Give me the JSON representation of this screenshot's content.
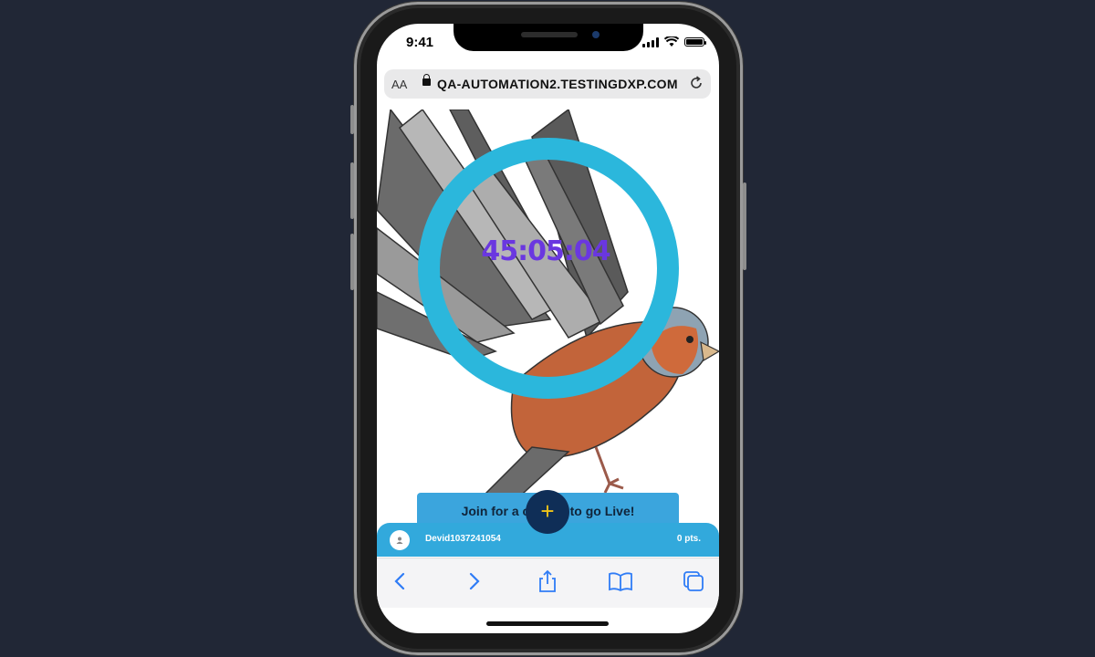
{
  "status_bar": {
    "time": "9:41"
  },
  "browser": {
    "text_size_label": "AA",
    "url": "QA-AUTOMATION2.TESTINGDXP.COM"
  },
  "game": {
    "timer": "45:05:04",
    "join_button": "Join for a chance to go Live!",
    "add_label": "+"
  },
  "user": {
    "username": "Devid1037241054",
    "points": "0 pts."
  },
  "toolbar": {
    "icons": [
      "back-icon",
      "forward-icon",
      "share-icon",
      "bookmarks-icon",
      "tabs-icon"
    ]
  },
  "colors": {
    "background": "#212736",
    "ring": "#2bb7dc",
    "timer": "#6a37e0",
    "join": "#3ba5dd",
    "fab": "#0f2e57",
    "fab_plus": "#f0c419",
    "userbar": "#32a9dc",
    "toolbar_icon": "#2f7cf6"
  }
}
